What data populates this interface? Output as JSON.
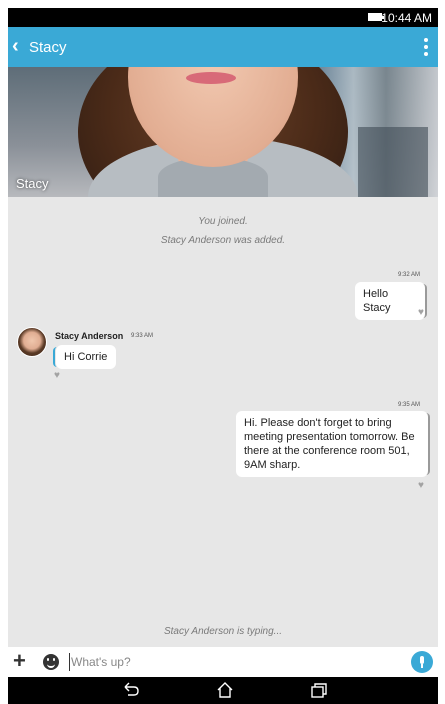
{
  "status_bar": {
    "time": "10:44 AM"
  },
  "app_bar": {
    "title": "Stacy"
  },
  "hero": {
    "name_overlay": "Stacy"
  },
  "system_messages": [
    "You joined.",
    "Stacy Anderson was added."
  ],
  "messages": [
    {
      "direction": "out",
      "time": "9:32 AM",
      "text": "Hello Stacy"
    },
    {
      "direction": "in",
      "sender": "Stacy Anderson",
      "time": "9:33 AM",
      "text": "Hi Corrie"
    },
    {
      "direction": "out",
      "time": "9:35 AM",
      "text": "Hi. Please don't forget to bring meeting presentation tomorrow. Be there at the conference room 501, 9AM sharp."
    }
  ],
  "typing_indicator": "Stacy Anderson is typing...",
  "composer": {
    "placeholder": "What's up?"
  },
  "colors": {
    "accent": "#3aa9d6",
    "chat_background": "#e7e7e7"
  }
}
